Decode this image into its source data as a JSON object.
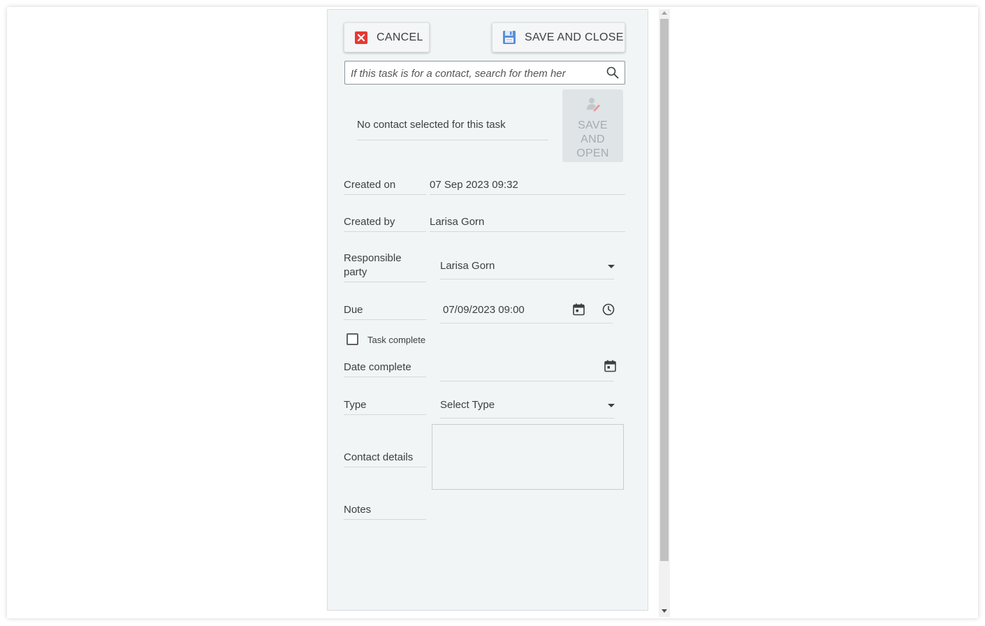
{
  "toolbar": {
    "cancel_label": "CANCEL",
    "save_close_label": "SAVE AND CLOSE"
  },
  "contact": {
    "search_placeholder": "If this task is for a contact, search for them her",
    "no_contact_text": "No contact selected for this task",
    "save_open_label": "SAVE AND OPEN"
  },
  "fields": {
    "created_on_label": "Created on",
    "created_on_value": "07 Sep 2023 09:32",
    "created_by_label": "Created by",
    "created_by_value": "Larisa Gorn",
    "responsible_label": "Responsible party",
    "responsible_value": "Larisa Gorn",
    "due_label": "Due",
    "due_value": "07/09/2023 09:00",
    "task_complete_label": "Task complete",
    "task_complete_checked": false,
    "date_complete_label": "Date complete",
    "date_complete_value": "",
    "type_label": "Type",
    "type_value": "Select Type",
    "contact_details_label": "Contact details",
    "notes_label": "Notes"
  },
  "colors": {
    "cancel_icon": "#e53935",
    "save_icon": "#5b8fd9",
    "panel_bg": "#f2f5f6"
  },
  "icons": {
    "cancel": "close-square-icon",
    "save": "floppy-disk-icon",
    "search": "search-icon",
    "save_open": "person-edit-icon",
    "calendar": "calendar-icon",
    "clock": "clock-icon",
    "dropdown": "chevron-down-icon"
  }
}
